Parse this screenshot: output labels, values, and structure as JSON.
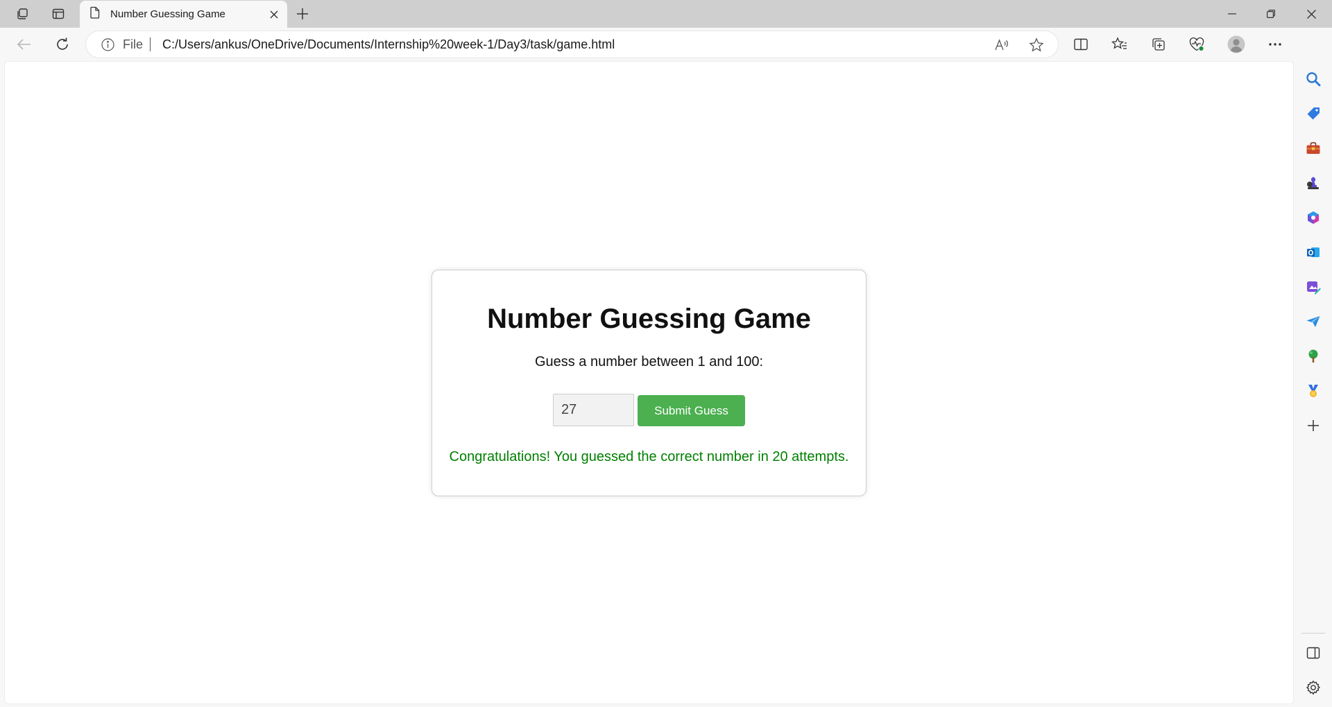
{
  "browser": {
    "tab": {
      "title": "Number Guessing Game"
    },
    "address": {
      "scheme_label": "File",
      "url": "C:/Users/ankus/OneDrive/Documents/Internship%20week-1/Day3/task/game.html"
    }
  },
  "game": {
    "title": "Number Guessing Game",
    "prompt": "Guess a number between 1 and 100:",
    "input_value": "27",
    "submit_label": "Submit Guess",
    "message": "Congratulations! You guessed the correct number in 20 attempts.",
    "message_color": "#008000",
    "button_color": "#4caf50"
  },
  "icons": {
    "titlebar": [
      "workspaces-icon",
      "tab-actions-icon",
      "page-icon",
      "close-tab-icon",
      "new-tab-icon",
      "minimize-icon",
      "restore-icon",
      "close-window-icon"
    ],
    "toolbar": [
      "back-icon",
      "refresh-icon",
      "info-icon",
      "read-aloud-icon",
      "favorite-star-icon",
      "split-screen-icon",
      "favorites-icon",
      "collections-icon",
      "browser-essentials-icon",
      "profile-avatar-icon",
      "more-options-icon",
      "copilot-icon"
    ],
    "sidebar": [
      "search-icon",
      "shopping-icon",
      "tools-icon",
      "games-icon",
      "microsoft-365-icon",
      "outlook-icon",
      "designer-icon",
      "send-icon",
      "tree-icon",
      "medal-icon",
      "add-icon",
      "sidebar-toggle-icon",
      "settings-icon"
    ]
  }
}
